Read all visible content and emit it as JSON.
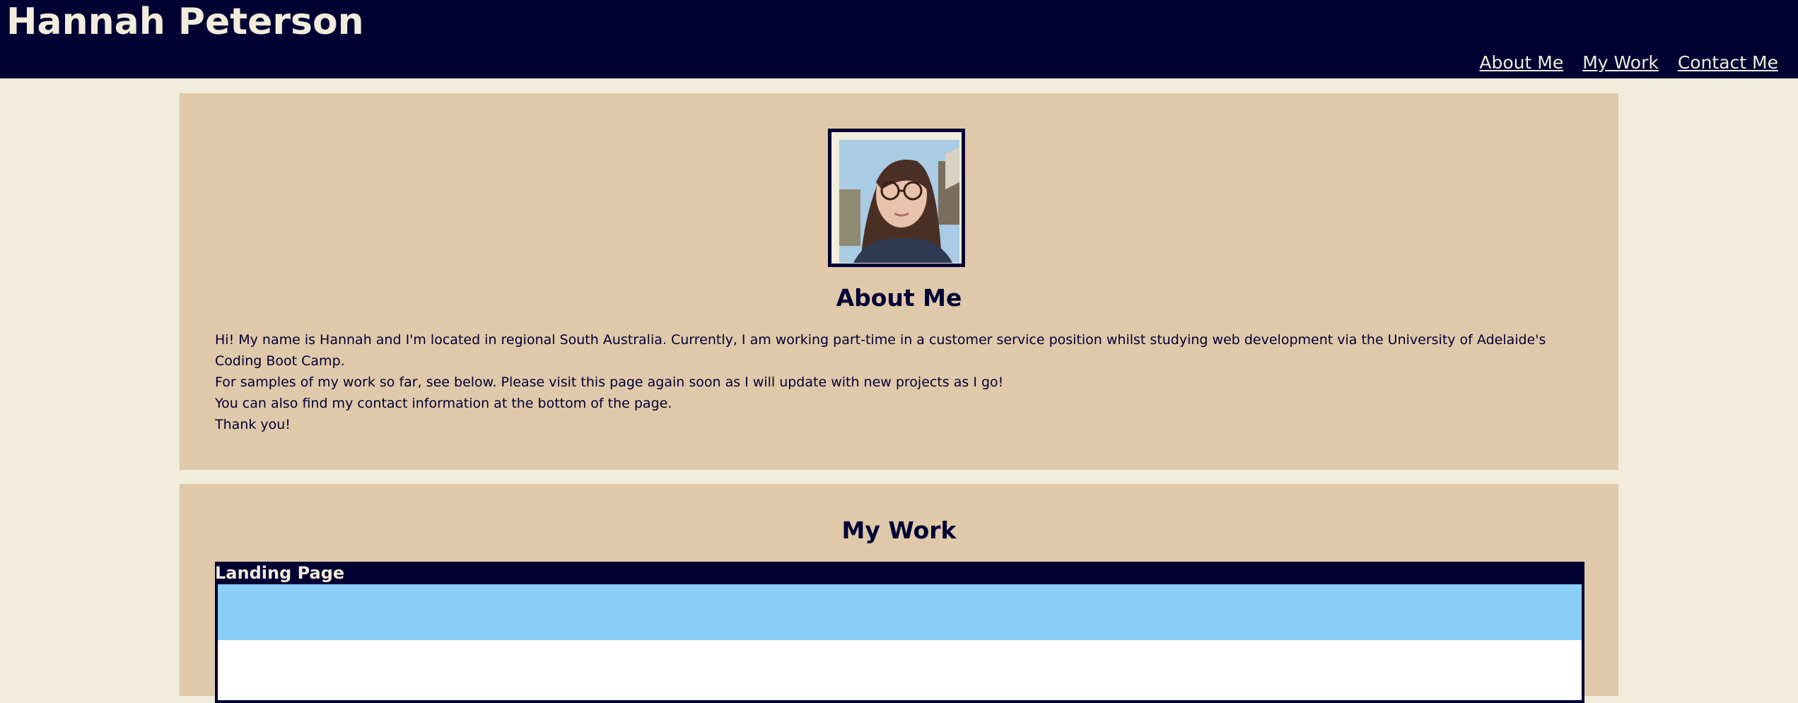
{
  "header": {
    "site_title": "Hannah Peterson",
    "nav": {
      "about": "About Me",
      "work": "My Work",
      "contact": "Contact Me"
    }
  },
  "about": {
    "heading": "About Me",
    "photo_alt": "Photo of Hannah Peterson",
    "paragraphs": [
      "Hi! My name is Hannah and I'm located in regional South Australia. Currently, I am working part-time in a customer service position whilst studying web development via the University of Adelaide's Coding Boot Camp.",
      "For samples of my work so far, see below. Please visit this page again soon as I will update with new projects as I go!",
      "You can also find my contact information at the bottom of the page.",
      "Thank you!"
    ]
  },
  "work": {
    "heading": "My Work",
    "projects": [
      {
        "title": "Landing Page"
      }
    ]
  },
  "colors": {
    "header_bg": "#000033",
    "page_bg": "#f1ecdc",
    "card_bg": "#e0c9ab",
    "accent_blue": "#8acef7"
  }
}
